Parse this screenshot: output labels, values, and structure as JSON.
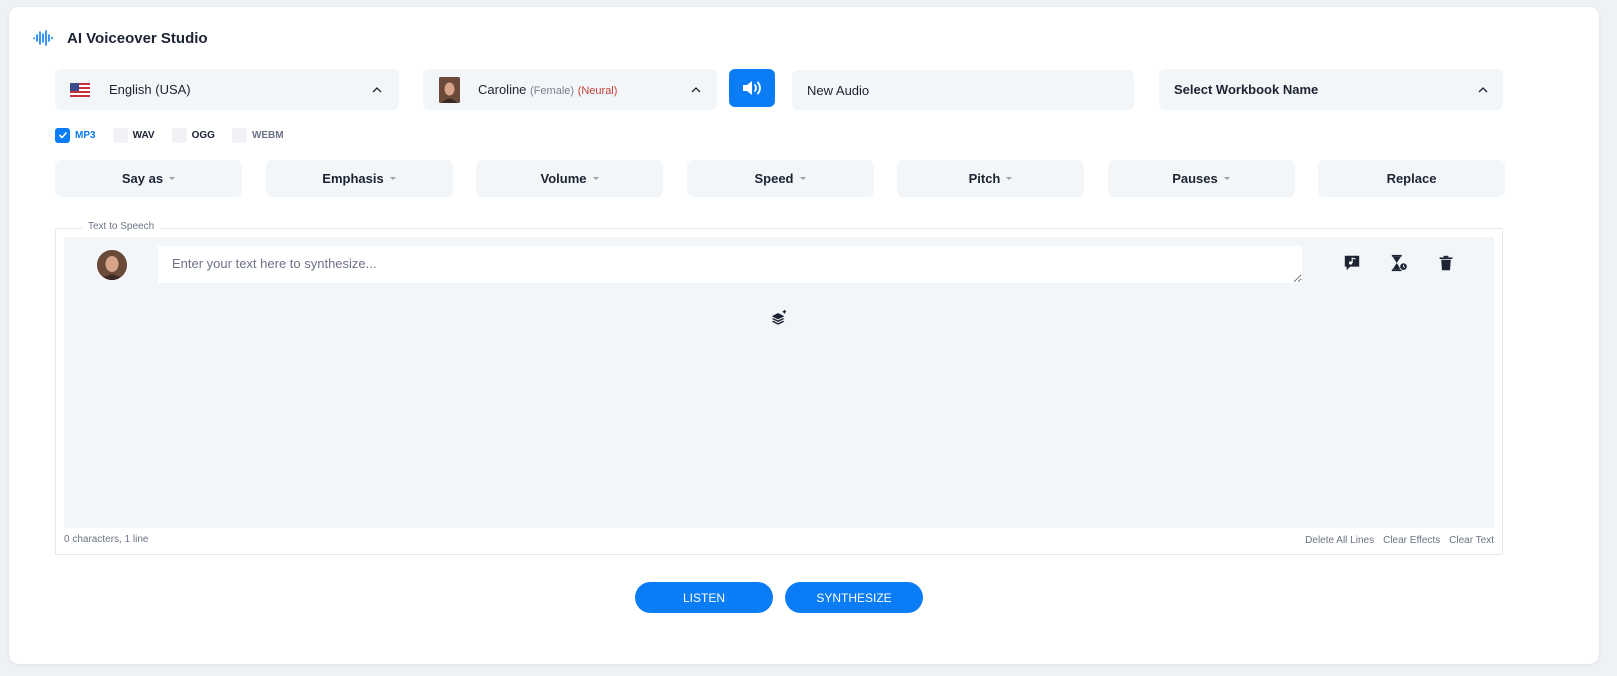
{
  "app": {
    "title": "AI Voiceover Studio"
  },
  "language": {
    "label": "English (USA)"
  },
  "voice": {
    "name": "Caroline",
    "gender": "(Female)",
    "type": "(Neural)"
  },
  "audio_name": {
    "value": "New Audio",
    "placeholder": "Audio name"
  },
  "workbook": {
    "label": "Select Workbook Name"
  },
  "formats": [
    {
      "label": "MP3",
      "checked": true
    },
    {
      "label": "WAV",
      "checked": false
    },
    {
      "label": "OGG",
      "checked": false
    },
    {
      "label": "WEBM",
      "checked": false
    }
  ],
  "effects": [
    {
      "label": "Say as"
    },
    {
      "label": "Emphasis"
    },
    {
      "label": "Volume"
    },
    {
      "label": "Speed"
    },
    {
      "label": "Pitch"
    },
    {
      "label": "Pauses"
    },
    {
      "label": "Replace"
    }
  ],
  "tts": {
    "legend": "Text to Speech",
    "placeholder": "Enter your text here to synthesize...",
    "stats": "0 characters, 1 line"
  },
  "footer_links": {
    "delete_all": "Delete All Lines",
    "clear_effects": "Clear Effects",
    "clear_text": "Clear Text"
  },
  "actions": {
    "listen": "LISTEN",
    "synthesize": "SYNTHESIZE"
  },
  "colors": {
    "accent": "#0a7cf5",
    "neural": "#c2413b",
    "panel": "#f3f6f9"
  }
}
